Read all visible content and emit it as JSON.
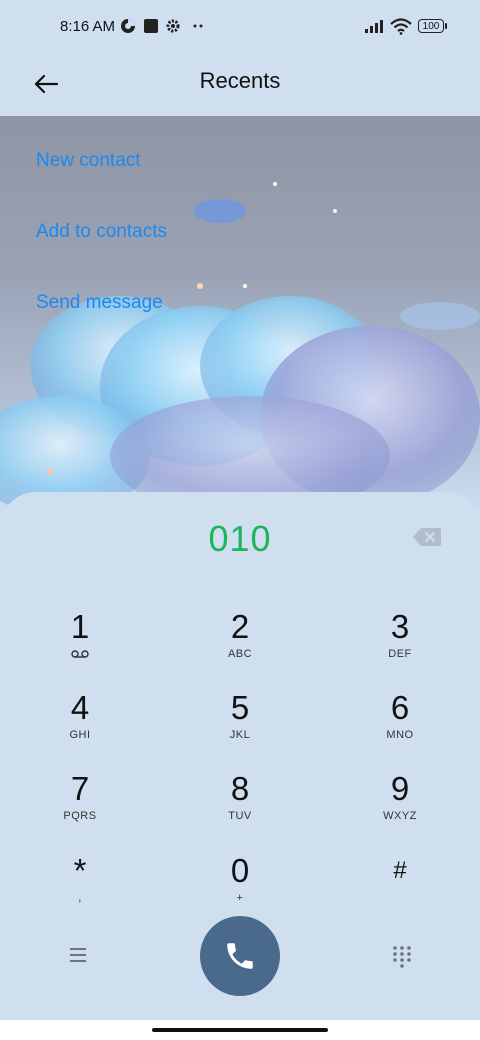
{
  "status_bar": {
    "time": "8:16 AM",
    "battery": "100",
    "icons": [
      "data-saver-icon",
      "square-notification-icon",
      "settings-icon",
      "more-dots-icon",
      "signal-icon",
      "wifi-icon",
      "battery-icon"
    ]
  },
  "header": {
    "title": "Recents",
    "back_icon": "back-arrow-icon"
  },
  "actions": [
    {
      "label": "New contact"
    },
    {
      "label": "Add to contacts"
    },
    {
      "label": "Send message"
    }
  ],
  "dialer": {
    "number": "010",
    "keys": [
      {
        "digit": "1",
        "letters": ""
      },
      {
        "digit": "2",
        "letters": "ABC"
      },
      {
        "digit": "3",
        "letters": "DEF"
      },
      {
        "digit": "4",
        "letters": "GHI"
      },
      {
        "digit": "5",
        "letters": "JKL"
      },
      {
        "digit": "6",
        "letters": "MNO"
      },
      {
        "digit": "7",
        "letters": "PQRS"
      },
      {
        "digit": "8",
        "letters": "TUV"
      },
      {
        "digit": "9",
        "letters": "WXYZ"
      },
      {
        "digit": "*",
        "letters": ","
      },
      {
        "digit": "0",
        "letters": "+"
      },
      {
        "digit": "#",
        "letters": ""
      }
    ]
  },
  "colors": {
    "background": "#cfdff0",
    "link": "#1e88f0",
    "number": "#1fb45a",
    "call_button": "#4a6a8c"
  }
}
